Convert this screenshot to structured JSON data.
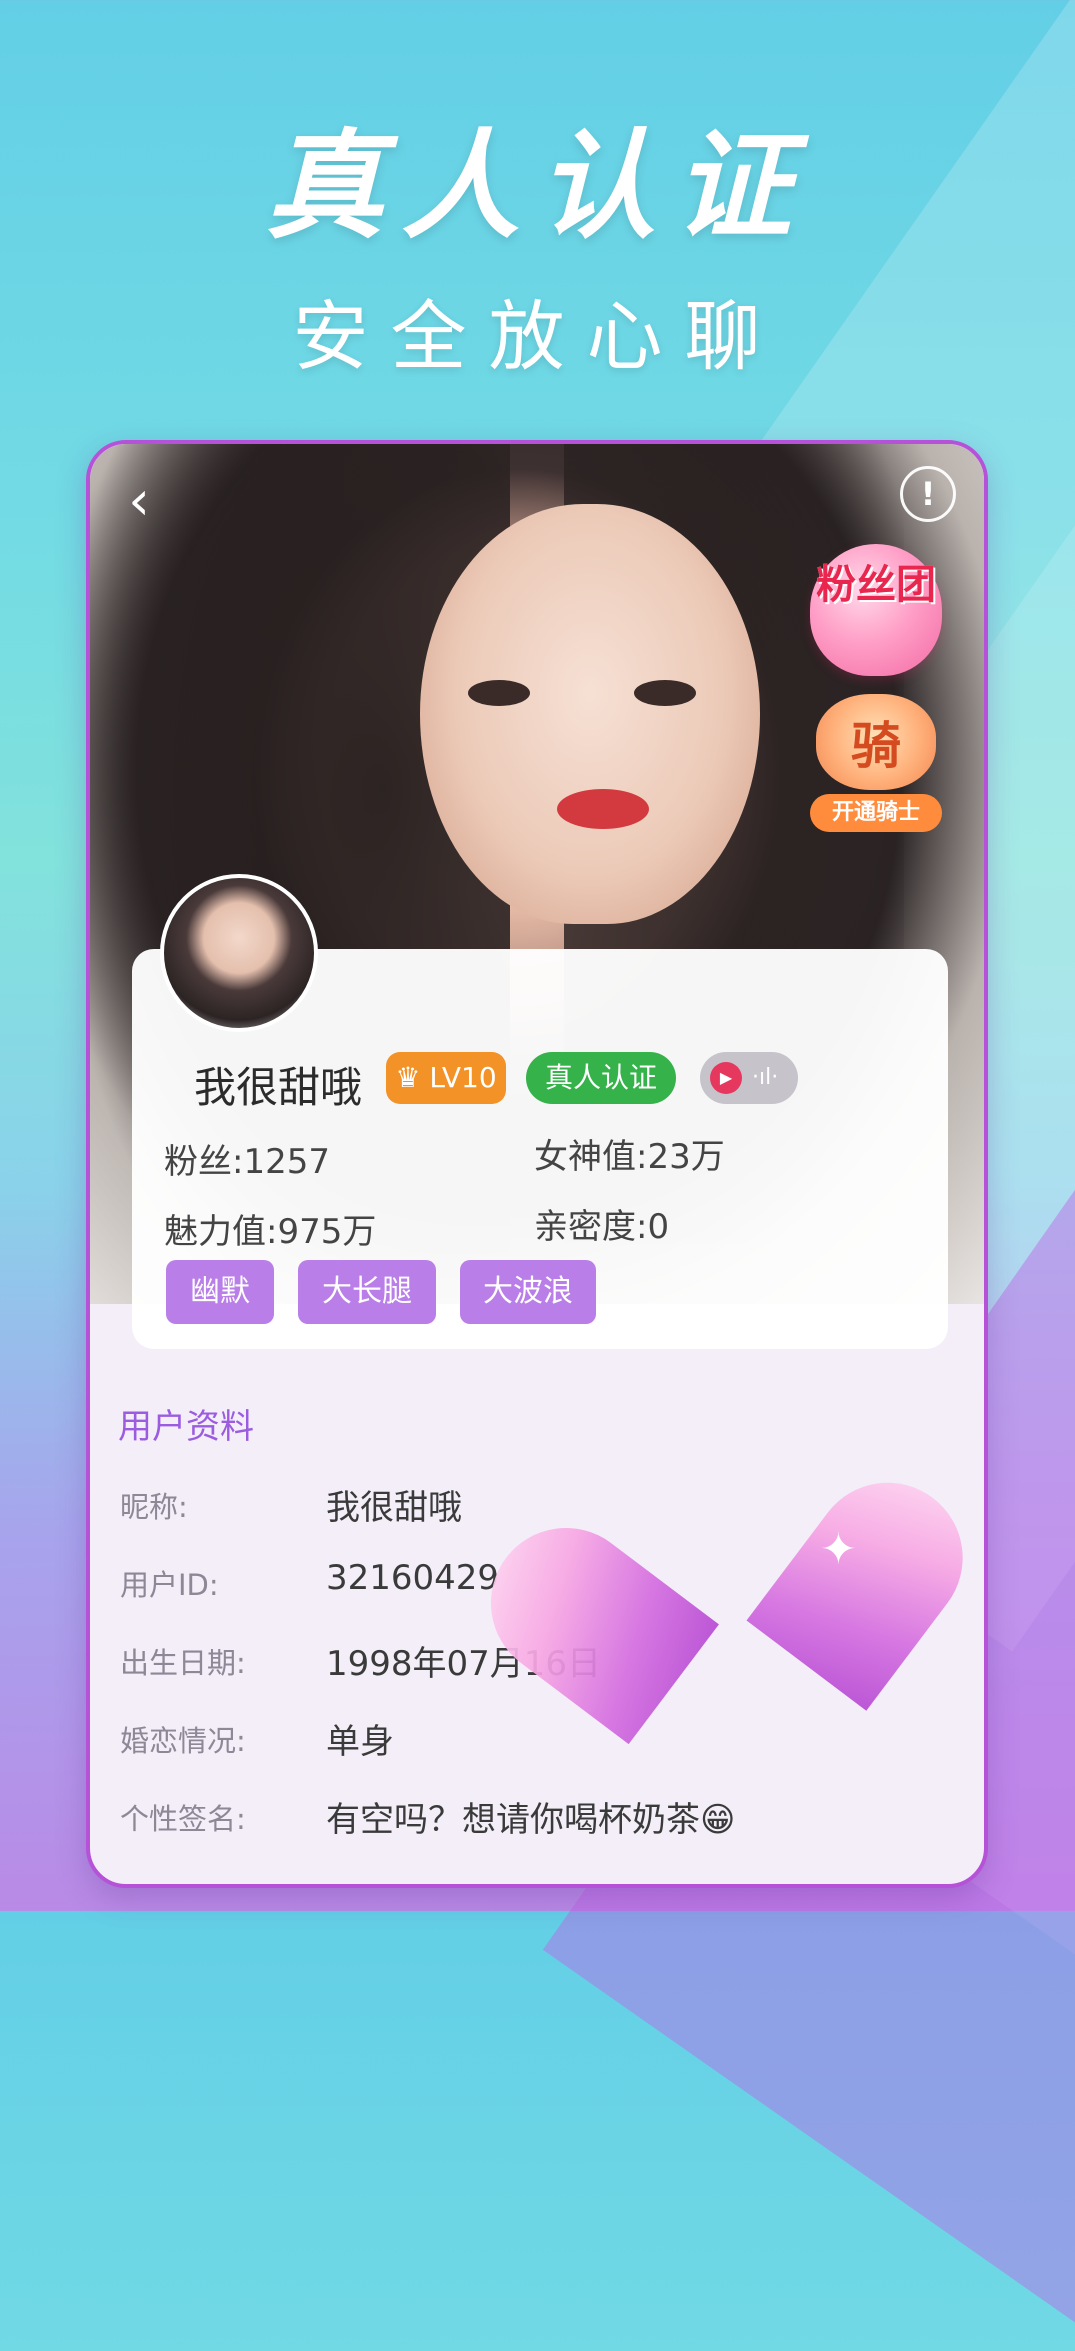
{
  "banner": {
    "headline": "真人认证",
    "subline": "安全放心聊"
  },
  "icons": {
    "back": "chevron-left-icon",
    "report": "exclamation-circle-icon",
    "crown": "crown-icon",
    "play": "play-icon"
  },
  "profile": {
    "badges": {
      "fan_group": "粉丝团",
      "knight_char": "骑",
      "knight_label": "开通骑士"
    },
    "name": "我很甜哦",
    "level_badge": "♛ LV10",
    "verified_badge": "真人认证",
    "stats": {
      "fans": "粉丝:1257",
      "goddess": "女神值:23万",
      "charm": "魅力值:975万",
      "intimacy": "亲密度:0"
    },
    "tags": [
      "幽默",
      "大长腿",
      "大波浪"
    ]
  },
  "user_info": {
    "section_title": "用户资料",
    "fields": [
      {
        "label": "昵称:",
        "value": "我很甜哦"
      },
      {
        "label": "用户ID:",
        "value": "32160429"
      },
      {
        "label": "出生日期:",
        "value": "1998年07月16日"
      },
      {
        "label": "婚恋情况:",
        "value": "单身"
      },
      {
        "label": "个性签名:",
        "value": "有空吗？想请你喝杯奶茶😁"
      }
    ]
  },
  "colors": {
    "accent_purple": "#b552d8",
    "tag_purple": "#b97ee8",
    "level_orange": "#f39226",
    "verified_green": "#36b24a"
  }
}
